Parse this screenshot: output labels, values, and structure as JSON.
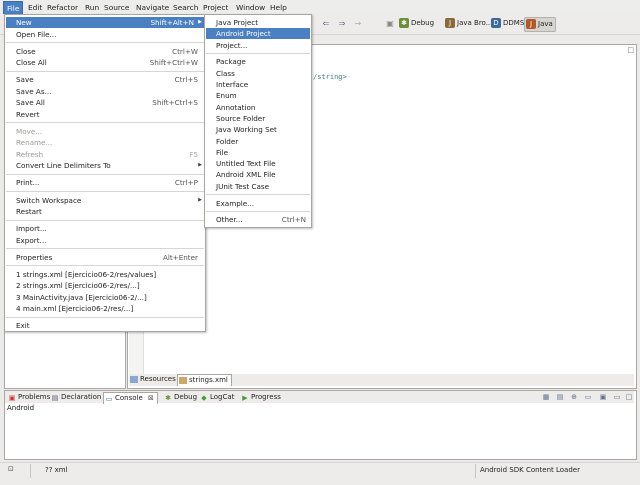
{
  "menubar": [
    "File",
    "Edit",
    "Refactor",
    "Run",
    "Source",
    "Navigate",
    "Search",
    "Project",
    "Window",
    "Help"
  ],
  "perspectives": [
    {
      "label": "Debug",
      "icon": "debug-icon",
      "color": "#6b8e3a"
    },
    {
      "label": "Java Bro...",
      "icon": "java-browse-icon",
      "color": "#8a6a3a"
    },
    {
      "label": "DDMS",
      "icon": "ddms-icon",
      "color": "#3a6a9a"
    },
    {
      "label": "Java",
      "icon": "java-icon",
      "color": "#b05a2a"
    }
  ],
  "file_menu": {
    "items": [
      {
        "label": "New",
        "accel": "Shift+Alt+N",
        "submenu": true,
        "highlighted": true
      },
      {
        "label": "Open File..."
      },
      {
        "sep": true
      },
      {
        "label": "Close",
        "accel": "Ctrl+W"
      },
      {
        "label": "Close All",
        "accel": "Shift+Ctrl+W"
      },
      {
        "sep": true
      },
      {
        "label": "Save",
        "accel": "Ctrl+S"
      },
      {
        "label": "Save As..."
      },
      {
        "label": "Save All",
        "accel": "Shift+Ctrl+S"
      },
      {
        "label": "Revert"
      },
      {
        "sep": true
      },
      {
        "label": "Move...",
        "disabled": true
      },
      {
        "label": "Rename...",
        "disabled": true
      },
      {
        "label": "Refresh",
        "accel": "F5",
        "disabled": true
      },
      {
        "label": "Convert Line Delimiters To",
        "submenu": true
      },
      {
        "sep": true
      },
      {
        "label": "Print...",
        "accel": "Ctrl+P"
      },
      {
        "sep": true
      },
      {
        "label": "Switch Workspace",
        "submenu": true
      },
      {
        "label": "Restart"
      },
      {
        "sep": true
      },
      {
        "label": "Import..."
      },
      {
        "label": "Export..."
      },
      {
        "sep": true
      },
      {
        "label": "Properties",
        "accel": "Alt+Enter"
      },
      {
        "sep": true
      },
      {
        "label": "1 strings.xml  [Ejercicio06-2/res/values]"
      },
      {
        "label": "2 strings.xml  [Ejercicio06-2/res/...]"
      },
      {
        "label": "3 MainActivity.java  [Ejercicio06-2/...]"
      },
      {
        "label": "4 main.xml  [Ejercicio06-2/res/...]"
      },
      {
        "sep": true
      },
      {
        "label": "Exit"
      }
    ]
  },
  "new_submenu": {
    "items": [
      {
        "label": "Java Project"
      },
      {
        "label": "Android Project",
        "highlighted": true
      },
      {
        "label": "Project..."
      },
      {
        "sep": true
      },
      {
        "label": "Package"
      },
      {
        "label": "Class"
      },
      {
        "label": "Interface"
      },
      {
        "label": "Enum"
      },
      {
        "label": "Annotation"
      },
      {
        "label": "Source Folder"
      },
      {
        "label": "Java Working Set"
      },
      {
        "label": "Folder"
      },
      {
        "label": "File"
      },
      {
        "label": "Untitled Text File"
      },
      {
        "label": "Android XML File"
      },
      {
        "label": "JUnit Test Case"
      },
      {
        "sep": true
      },
      {
        "label": "Example..."
      },
      {
        "sep": true
      },
      {
        "label": "Other...",
        "accel": "Ctrl+N"
      }
    ]
  },
  "editor": {
    "visible_text": "/string>",
    "bottom_tabs": [
      {
        "label": "Resources",
        "selected": false
      },
      {
        "label": "strings.xml",
        "selected": true
      }
    ]
  },
  "bottom_panel": {
    "tabs": [
      {
        "label": "Problems",
        "icon": "problems-icon"
      },
      {
        "label": "Declaration",
        "icon": "declaration-icon"
      },
      {
        "label": "Console",
        "icon": "console-icon",
        "selected": true,
        "close": "⊠"
      },
      {
        "label": "Debug",
        "icon": "debug-icon"
      },
      {
        "label": "LogCat",
        "icon": "logcat-icon"
      },
      {
        "label": "Progress",
        "icon": "progress-icon"
      }
    ],
    "console_name": "Android"
  },
  "status": {
    "left": "?? xml",
    "right": "Android SDK Content Loader"
  }
}
